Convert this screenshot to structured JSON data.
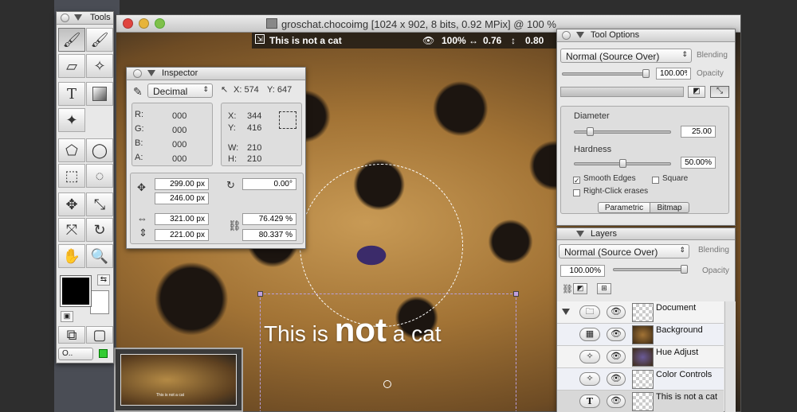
{
  "tools_palette": {
    "title": "Tools",
    "zoom_label": "O.."
  },
  "document": {
    "title": "groschat.chocoimg [1024 x 902, 8 bits, 0.92 MPix] @ 100 %",
    "layer_name": "This is not a cat",
    "overlay_zoom": "100%",
    "overlay_hscale": "0.76",
    "overlay_vscale": "0.80",
    "canvas_text_pre": "This is",
    "canvas_text_bold": "not",
    "canvas_text_post": "a cat",
    "thumb_text": "This is not a cat"
  },
  "inspector": {
    "title": "Inspector",
    "mode": "Decimal",
    "cursor_x": "X: 574",
    "cursor_y": "Y: 647",
    "r_label": "R:",
    "g_label": "G:",
    "b_label": "B:",
    "a_label": "A:",
    "r": "000",
    "g": "000",
    "b": "000",
    "a": "000",
    "x_label": "X:",
    "y_label": "Y:",
    "w_label": "W:",
    "h_label": "H:",
    "sel_x": "344",
    "sel_y": "416",
    "sel_w": "210",
    "sel_h": "210",
    "pos_x": "299.00 px",
    "pos_y": "246.00 px",
    "rotation": "0.00°",
    "width": "321.00 px",
    "height": "221.00 px",
    "scale_w": "76.429 %",
    "scale_h": "80.337 %"
  },
  "tool_options": {
    "title": "Tool Options",
    "blend_mode": "Normal (Source Over)",
    "blending_label": "Blending",
    "opacity_value": "100.00%",
    "opacity_label": "Opacity",
    "opacity_level": 1.0,
    "diameter_label": "Diameter",
    "diameter_value": "25.00",
    "diameter_level": 0.13,
    "hardness_label": "Hardness",
    "hardness_value": "50.00%",
    "hardness_level": 0.5,
    "smooth_edges_label": "Smooth Edges",
    "smooth_edges_checked": true,
    "square_label": "Square",
    "square_checked": false,
    "right_click_label": "Right-Click erases",
    "right_click_checked": false,
    "seg_parametric": "Parametric",
    "seg_bitmap": "Bitmap"
  },
  "layers": {
    "title": "Layers",
    "blend_mode": "Normal (Source Over)",
    "blending_label": "Blending",
    "opacity_value": "100.00%",
    "opacity_label": "Opacity",
    "items": [
      {
        "name": "Document",
        "icon": "folder-icon"
      },
      {
        "name": "Background",
        "icon": "checker-icon"
      },
      {
        "name": "Hue Adjust",
        "icon": "filter-icon"
      },
      {
        "name": "Color Controls",
        "icon": "filter-icon"
      },
      {
        "name": "This is not a cat",
        "icon": "text-icon"
      }
    ]
  }
}
